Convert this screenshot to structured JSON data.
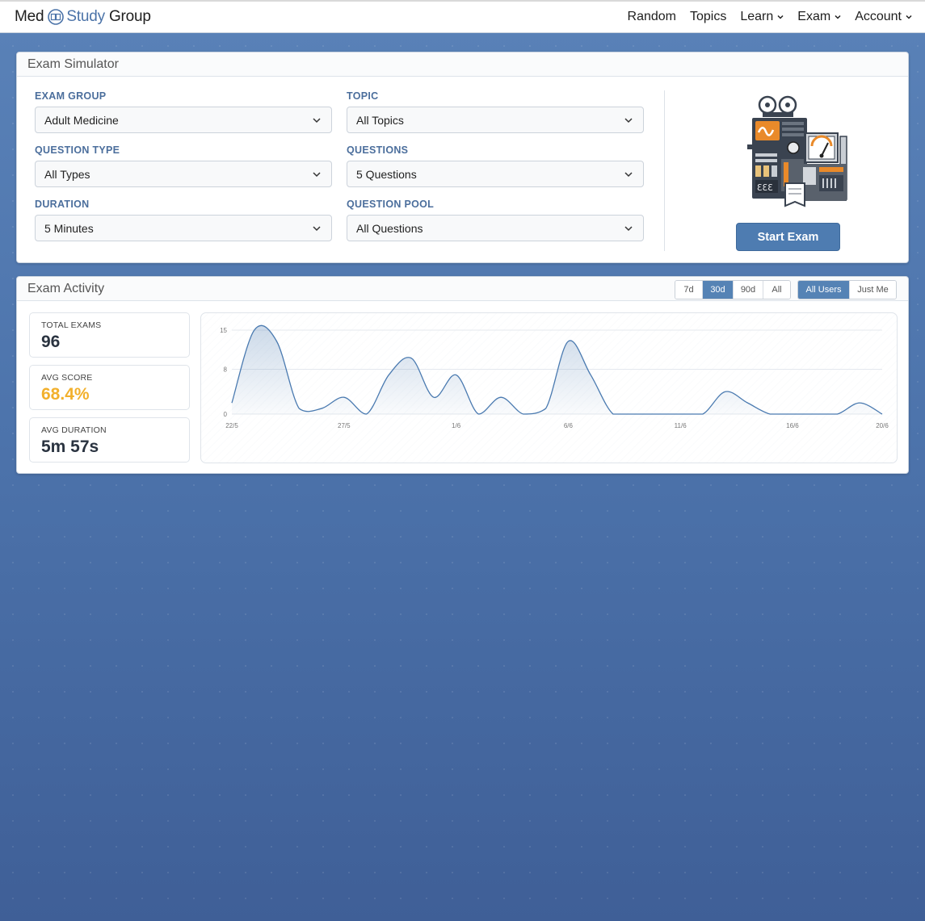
{
  "nav": {
    "logo": {
      "word1": "Med",
      "word2": "Study",
      "word3": "Group"
    },
    "links": [
      "Random",
      "Topics",
      "Learn",
      "Exam",
      "Account"
    ]
  },
  "simulator": {
    "title": "Exam Simulator",
    "fields": {
      "exam_group": {
        "label": "EXAM GROUP",
        "value": "Adult Medicine"
      },
      "topic": {
        "label": "TOPIC",
        "value": "All Topics"
      },
      "question_type": {
        "label": "QUESTION TYPE",
        "value": "All Types"
      },
      "questions": {
        "label": "QUESTIONS",
        "value": "5 Questions"
      },
      "duration": {
        "label": "DURATION",
        "value": "5 Minutes"
      },
      "question_pool": {
        "label": "QUESTION POOL",
        "value": "All Questions"
      }
    },
    "start_button": "Start Exam"
  },
  "activity": {
    "title": "Exam Activity",
    "ranges": [
      "7d",
      "30d",
      "90d",
      "All"
    ],
    "active_range": "30d",
    "scopes": [
      "All Users",
      "Just Me"
    ],
    "active_scope": "All Users",
    "stats": {
      "total_exams": {
        "label": "TOTAL EXAMS",
        "value": "96"
      },
      "avg_score": {
        "label": "AVG SCORE",
        "value": "68.4%"
      },
      "avg_duration": {
        "label": "AVG DURATION",
        "value": "5m 57s"
      }
    }
  },
  "colors": {
    "accent": "#4e7cb1",
    "label": "#4b6e9c",
    "score": "#f2b02c",
    "line": "#4a7ab0"
  },
  "chart_data": {
    "type": "area",
    "x": [
      "22/5",
      "23/5",
      "24/5",
      "25/5",
      "26/5",
      "27/5",
      "28/5",
      "29/5",
      "30/5",
      "31/5",
      "1/6",
      "2/6",
      "3/6",
      "4/6",
      "5/6",
      "6/6",
      "7/6",
      "8/6",
      "9/6",
      "10/6",
      "11/6",
      "12/6",
      "13/6",
      "14/6",
      "15/6",
      "16/6",
      "17/6",
      "18/6",
      "19/6",
      "20/6"
    ],
    "values": [
      2,
      15,
      13,
      1,
      1,
      3,
      0,
      7,
      10,
      3,
      7,
      0,
      3,
      0,
      1,
      13,
      7,
      0,
      0,
      0,
      0,
      0,
      4,
      2,
      0,
      0,
      0,
      0,
      2,
      0
    ],
    "x_ticks": [
      "22/5",
      "27/5",
      "1/6",
      "6/6",
      "11/6",
      "16/6",
      "20/6"
    ],
    "y_ticks": [
      "0",
      "8",
      "15"
    ],
    "ylim": [
      0,
      15
    ],
    "grid": true
  }
}
